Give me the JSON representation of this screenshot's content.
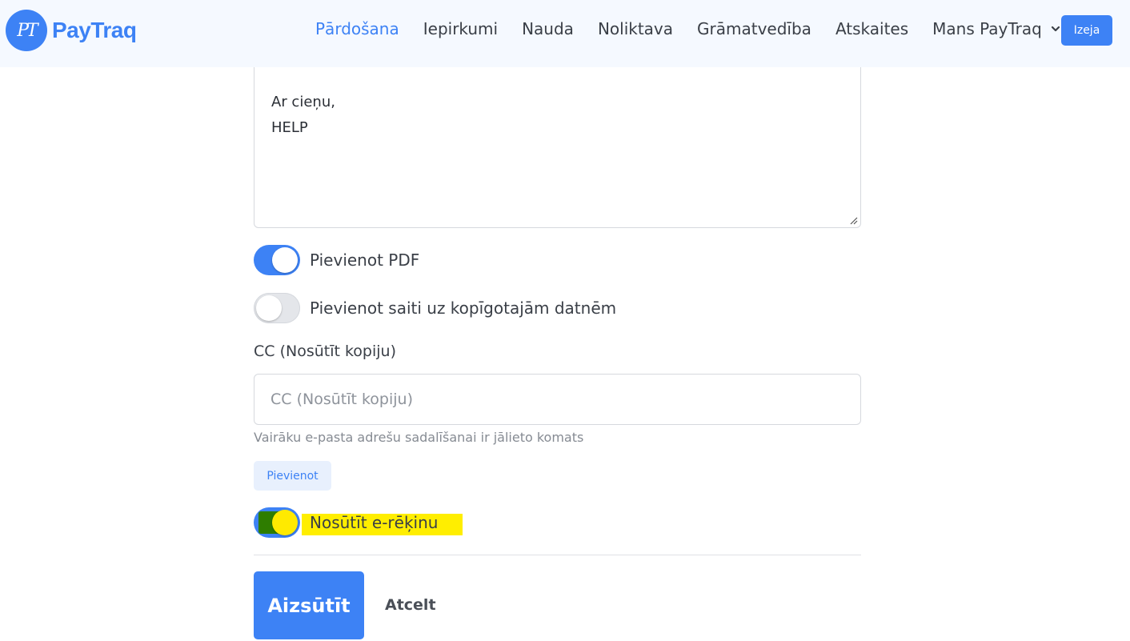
{
  "brand": {
    "name": "PayTraq",
    "mark": "PT"
  },
  "nav": {
    "items": [
      {
        "label": "Pārdošana",
        "active": true
      },
      {
        "label": "Iepirkumi"
      },
      {
        "label": "Nauda"
      },
      {
        "label": "Noliktava"
      },
      {
        "label": "Grāmatvedība"
      },
      {
        "label": "Atskaites"
      },
      {
        "label": "Mans PayTraq"
      }
    ],
    "logout_label": "Izeja"
  },
  "message": {
    "body": "Ar cieņu,\nHELP"
  },
  "toggles": {
    "attach_pdf": {
      "label": "Pievienot PDF",
      "on": true
    },
    "shared_link": {
      "label": "Pievienot saiti uz kopīgotajām datnēm",
      "on": false
    },
    "e_invoice": {
      "label": "Nosūtīt e-rēķinu",
      "on": true
    }
  },
  "cc": {
    "label": "CC (Nosūtīt kopiju)",
    "placeholder": "CC (Nosūtīt kopiju)",
    "value": "",
    "help": "Vairāku e-pasta adrešu sadalīšanai ir jālieto komats",
    "add_label": "Pievienot"
  },
  "actions": {
    "send_label": "Aizsūtīt",
    "cancel_label": "Atcelt"
  },
  "colors": {
    "accent": "#3d82f5",
    "highlight": "#ffee00"
  }
}
